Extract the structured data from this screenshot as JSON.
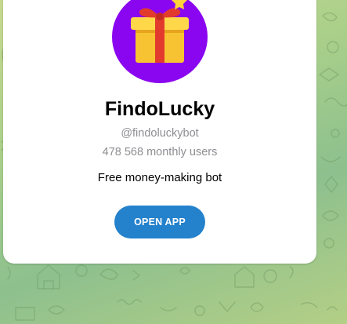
{
  "bot": {
    "name": "FindoLucky",
    "username": "@findoluckybot",
    "monthly_users": "478 568 monthly users",
    "description": "Free money-making bot"
  },
  "actions": {
    "open_app_label": "OPEN APP"
  },
  "avatar": {
    "icon": "gift-box-icon",
    "background_color": "#8a06f0"
  },
  "colors": {
    "button": "#2481cc",
    "card": "#ffffff",
    "secondary_text": "#8e8e93",
    "chat_background": "#a9cf8a"
  }
}
